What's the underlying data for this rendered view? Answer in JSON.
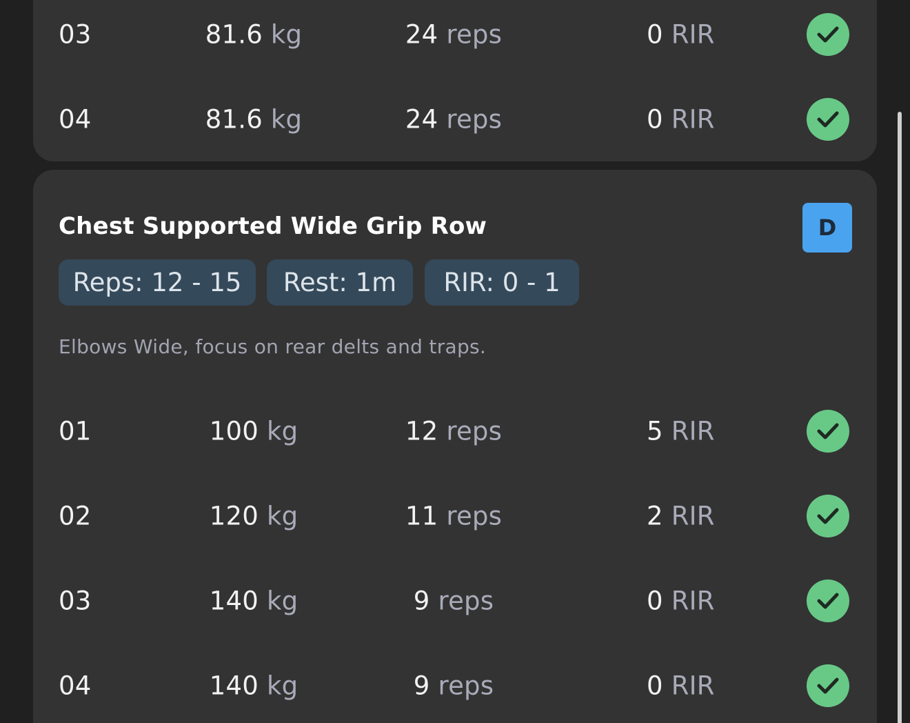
{
  "previous_exercise": {
    "sets": [
      {
        "num": "03",
        "weight": "81.6",
        "weight_unit": "kg",
        "reps": "24",
        "reps_unit": "reps",
        "rir": "0",
        "rir_unit": "RIR"
      },
      {
        "num": "04",
        "weight": "81.6",
        "weight_unit": "kg",
        "reps": "24",
        "reps_unit": "reps",
        "rir": "0",
        "rir_unit": "RIR"
      }
    ]
  },
  "exercise": {
    "title": "Chest Supported Wide Grip Row",
    "badge": "D",
    "chips": {
      "reps": "Reps: 12 - 15",
      "rest": "Rest: 1m",
      "rir": "RIR: 0 - 1"
    },
    "notes": "Elbows Wide, focus on rear delts and traps.",
    "sets": [
      {
        "num": "01",
        "weight": "100",
        "weight_unit": "kg",
        "reps": "12",
        "reps_unit": "reps",
        "rir": "5",
        "rir_unit": "RIR"
      },
      {
        "num": "02",
        "weight": "120",
        "weight_unit": "kg",
        "reps": "11",
        "reps_unit": "reps",
        "rir": "2",
        "rir_unit": "RIR"
      },
      {
        "num": "03",
        "weight": "140",
        "weight_unit": "kg",
        "reps": "9",
        "reps_unit": "reps",
        "rir": "0",
        "rir_unit": "RIR"
      },
      {
        "num": "04",
        "weight": "140",
        "weight_unit": "kg",
        "reps": "9",
        "reps_unit": "reps",
        "rir": "0",
        "rir_unit": "RIR"
      }
    ]
  },
  "icons": {
    "set_complete": "check-circle-icon"
  },
  "colors": {
    "background": "#202020",
    "card": "#333333",
    "check": "#68c987",
    "badge": "#4aa3ef",
    "chip": "#34495a",
    "unit_text": "#a9abb9"
  }
}
